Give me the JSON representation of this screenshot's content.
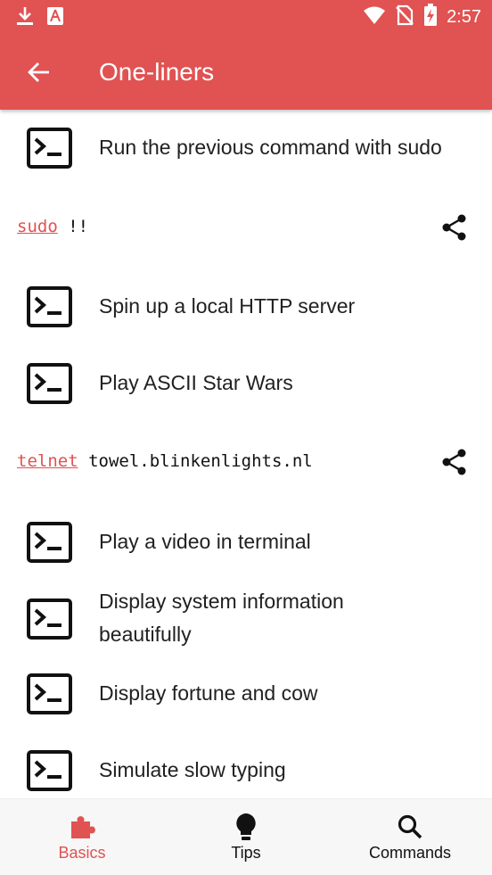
{
  "status_bar": {
    "time": "2:57",
    "icons": [
      "download-icon",
      "app-notification-icon",
      "wifi-icon",
      "no-sim-icon",
      "battery-charging-icon"
    ]
  },
  "toolbar": {
    "back_icon": "arrow-back-icon",
    "title": "One-liners"
  },
  "items": [
    {
      "label": "Run the previous command with sudo",
      "expanded": true,
      "command": {
        "keyword": "sudo",
        "rest": " !!"
      }
    },
    {
      "label": "Spin up a local HTTP server"
    },
    {
      "label": "Play ASCII Star Wars",
      "expanded": true,
      "command": {
        "keyword": "telnet",
        "rest": " towel.blinkenlights.nl"
      }
    },
    {
      "label": "Play a video in terminal"
    },
    {
      "label": "Display system information beautifully"
    },
    {
      "label": "Display fortune and cow"
    },
    {
      "label": "Simulate slow typing"
    }
  ],
  "bottom_nav": {
    "items": [
      {
        "label": "Basics",
        "icon": "puzzle-icon",
        "active": true
      },
      {
        "label": "Tips",
        "icon": "lightbulb-icon",
        "active": false
      },
      {
        "label": "Commands",
        "icon": "search-icon",
        "active": false
      }
    ]
  },
  "colors": {
    "accent": "#e15252",
    "text": "#212121",
    "nav_background": "#f7f7f7"
  }
}
